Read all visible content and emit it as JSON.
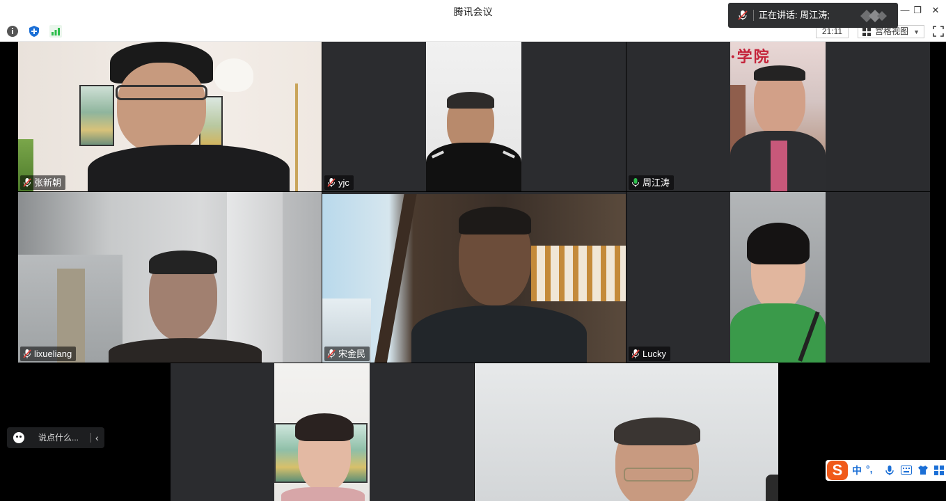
{
  "window": {
    "title": "腾讯会议"
  },
  "toolbar": {
    "clock": "21:11",
    "view_mode": "宫格视图"
  },
  "speaking": {
    "text": "正在讲话: 周江涛;"
  },
  "participants": [
    {
      "name": "张新朝",
      "mic": "muted"
    },
    {
      "name": "yjc",
      "mic": "muted"
    },
    {
      "name": "周江涛",
      "mic": "active"
    },
    {
      "name": "lixueliang",
      "mic": "muted"
    },
    {
      "name": "宋金民",
      "mic": "muted"
    },
    {
      "name": "Lucky",
      "mic": "muted"
    }
  ],
  "chat": {
    "placeholder": "说点什么..."
  },
  "ime": {
    "logo": "S",
    "mode": "中",
    "punct": "°,"
  },
  "colors": {
    "mic_active": "#2dbe4c",
    "mic_muted": "#e0413a",
    "tile_bg": "#2b2c2f",
    "ime_orange": "#f05a1a"
  }
}
